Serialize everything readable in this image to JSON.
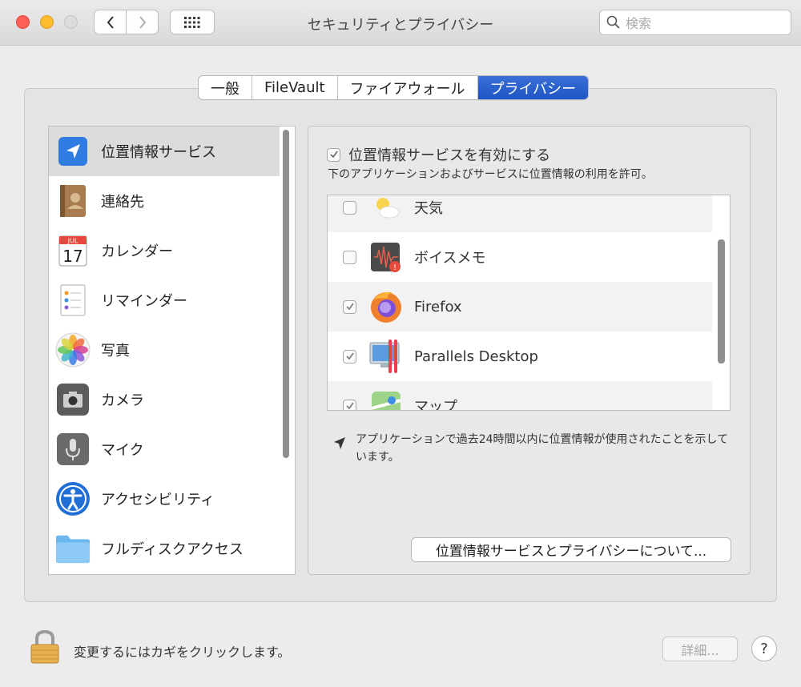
{
  "window": {
    "title": "セキュリティとプライバシー"
  },
  "search": {
    "placeholder": "検索"
  },
  "tabs": [
    {
      "label": "一般",
      "active": false
    },
    {
      "label": "FileVault",
      "active": false
    },
    {
      "label": "ファイアウォール",
      "active": false
    },
    {
      "label": "プライバシー",
      "active": true
    }
  ],
  "sidebar": {
    "items": [
      {
        "label": "位置情報サービス",
        "icon": "location-arrow-icon",
        "selected": true
      },
      {
        "label": "連絡先",
        "icon": "contacts-book-icon"
      },
      {
        "label": "カレンダー",
        "icon": "calendar-icon",
        "icon_month": "JUL",
        "icon_day": "17"
      },
      {
        "label": "リマインダー",
        "icon": "reminders-list-icon"
      },
      {
        "label": "写真",
        "icon": "photos-flower-icon"
      },
      {
        "label": "カメラ",
        "icon": "camera-icon"
      },
      {
        "label": "マイク",
        "icon": "microphone-icon"
      },
      {
        "label": "アクセシビリティ",
        "icon": "accessibility-icon"
      },
      {
        "label": "フルディスクアクセス",
        "icon": "folder-icon"
      }
    ]
  },
  "main": {
    "enable_label": "位置情報サービスを有効にする",
    "enable_checked": true,
    "subtitle": "下のアプリケーションおよびサービスに位置情報の利用を許可。",
    "apps": [
      {
        "name": "天気",
        "checked": false,
        "icon": "weather-icon"
      },
      {
        "name": "ボイスメモ",
        "checked": false,
        "icon": "voice-memos-icon"
      },
      {
        "name": "Firefox",
        "checked": true,
        "icon": "firefox-icon"
      },
      {
        "name": "Parallels Desktop",
        "checked": true,
        "icon": "parallels-icon"
      },
      {
        "name": "マップ",
        "checked": true,
        "icon": "maps-icon"
      }
    ],
    "note": "アプリケーションで過去24時間以内に位置情報が使用されたことを示しています。",
    "about_button": "位置情報サービスとプライバシーについて..."
  },
  "footer": {
    "lock_label": "変更するにはカギをクリックします。",
    "detail_button": "詳細...",
    "help_label": "?"
  },
  "colors": {
    "accent": "#1f55c4",
    "close": "#fe5f57",
    "minimize": "#febc2e"
  }
}
